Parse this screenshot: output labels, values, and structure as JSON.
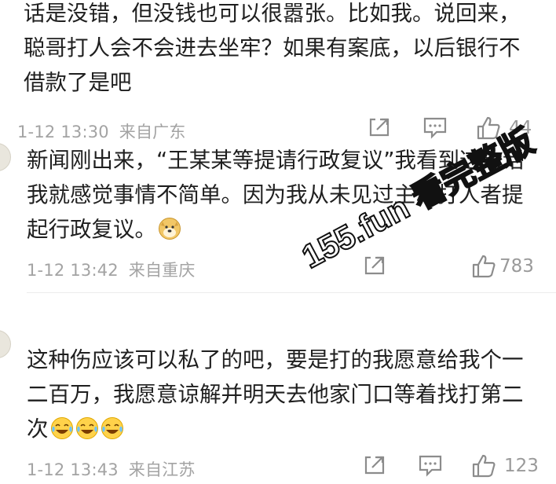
{
  "comments": [
    {
      "text": "话是没错，但没钱也可以很嚣张。比如我。说回来，聪哥打人会不会进去坐牢？如果有案底，以后银行不借款了是吧",
      "time": "1-12 13:30",
      "location": "来自广东",
      "likes": "44"
    },
    {
      "text": "新闻刚出来，“王某某等提请行政复议”我看到这句话我就感觉事情不简单。因为我从未见过主动打人者提起行政复议。",
      "time": "1-12 13:42",
      "location": "来自重庆",
      "likes": "783",
      "emoji": "doge-emoji"
    },
    {
      "text": "这种伤应该可以私了的吧，要是打的我愿意给我个一二百万，我愿意谅解并明天去他家门口等着找打第二次",
      "time": "1-12 13:43",
      "location": "来自江苏",
      "likes": "123",
      "emoji": "laugh-cry-emoji"
    }
  ],
  "watermark": "155.fun 看完整版",
  "icons": {
    "forward": "share-icon",
    "reply": "comment-icon",
    "like": "thumbs-up-icon"
  },
  "colors": {
    "meta_text": "#a3a3a3",
    "icon": "#8c8c8c",
    "divider": "#ececec"
  }
}
